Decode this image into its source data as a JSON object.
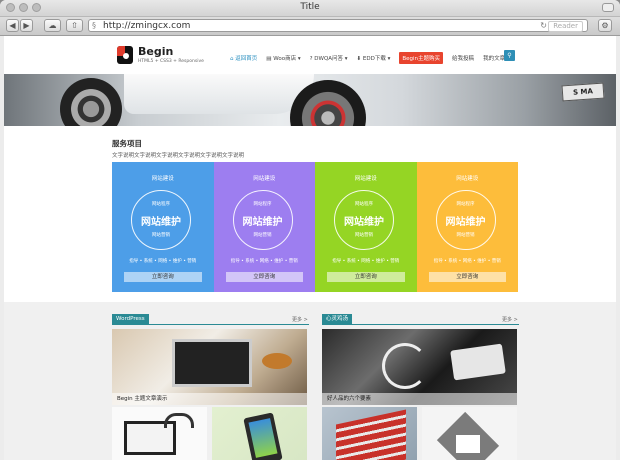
{
  "window": {
    "title": "Title"
  },
  "toolbar": {
    "url": "http://zmingcx.com",
    "reader": "Reader"
  },
  "site": {
    "logo_name": "Begin",
    "logo_tagline": "HTML5 + CSS3 + Responsive",
    "nav": [
      "返回首页",
      "Woo商店",
      "DWQA问答",
      "EDD下载",
      "Begin主题购买",
      "给我投稿",
      "我的文章"
    ],
    "nav_active_index": 0,
    "nav_hot_index": 4,
    "plate_text": "S MA"
  },
  "services": {
    "title": "服务项目",
    "desc": "文字说明文字说明文字说明文字说明文字说明文字说明",
    "cards": [
      {
        "color": "#4d9ee8",
        "top": "网站建设",
        "line1": "网站程序",
        "main": "网站维护",
        "line3": "网站营销",
        "tags": "指导 • 系统 • 网络 • 维护 • 营销",
        "button": "立即咨询"
      },
      {
        "color": "#9d7ef0",
        "top": "网站建设",
        "line1": "网站程序",
        "main": "网站维护",
        "line3": "网站营销",
        "tags": "指导 • 系统 • 网络 • 维护 • 营销",
        "button": "立即咨询"
      },
      {
        "color": "#95d524",
        "top": "网站建设",
        "line1": "网站程序",
        "main": "网站维护",
        "line3": "网站营销",
        "tags": "指导 • 系统 • 网络 • 维护 • 营销",
        "button": "立即咨询"
      },
      {
        "color": "#fdbd3b",
        "top": "网站建设",
        "line1": "网站程序",
        "main": "网站维护",
        "line3": "网站营销",
        "tags": "指导 • 系统 • 网络 • 维护 • 营销",
        "button": "立即咨询"
      }
    ]
  },
  "sections": [
    {
      "tag": "WordPress",
      "more": "更多 >",
      "hero_caption": "Begin 主题文章演示"
    },
    {
      "tag": "心灵鸡汤",
      "more": "更多 >",
      "hero_caption": "好人品的六个要素"
    }
  ]
}
